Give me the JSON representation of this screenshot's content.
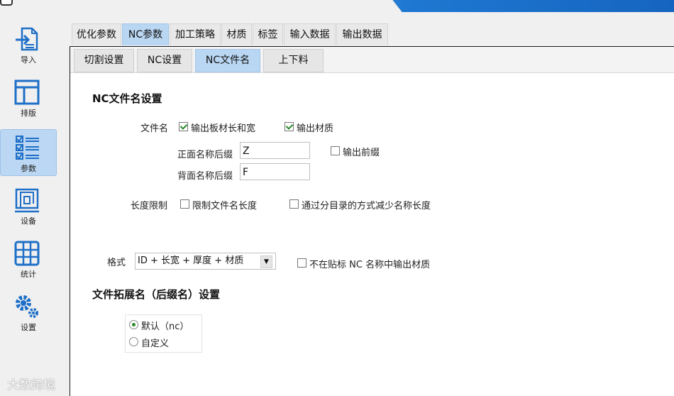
{
  "sidebar": {
    "items": [
      {
        "label": "导入",
        "icon": "import-icon"
      },
      {
        "label": "排版",
        "icon": "layout-icon"
      },
      {
        "label": "参数",
        "icon": "parameters-icon"
      },
      {
        "label": "设备",
        "icon": "machine-icon"
      },
      {
        "label": "统计",
        "icon": "statistics-icon"
      },
      {
        "label": "设置",
        "icon": "settings-gear-icon"
      }
    ],
    "active": "参数"
  },
  "main_tabs": [
    "优化参数",
    "NC参数",
    "加工策略",
    "材质",
    "标签",
    "输入数据",
    "输出数据"
  ],
  "main_tab_active": "NC参数",
  "sub_tabs": [
    "切割设置",
    "NC设置",
    "NC文件名",
    "上下料"
  ],
  "sub_tab_active": "NC文件名",
  "nc_filename": {
    "section_title": "NC文件名设置",
    "filename_label": "文件名",
    "output_board_size_label": "输出板材长和宽",
    "output_board_size_checked": true,
    "output_material_label": "输出材质",
    "output_material_checked": true,
    "front_suffix_label": "正面名称后缀",
    "front_suffix_value": "Z",
    "back_suffix_label": "背面名称后缀",
    "back_suffix_value": "F",
    "output_prefix_label": "输出前缀",
    "output_prefix_checked": false,
    "length_limit_label": "长度限制",
    "limit_filename_length_label": "限制文件名长度",
    "limit_filename_length_checked": false,
    "subdir_reduce_label": "通过分目录的方式减少名称长度",
    "subdir_reduce_checked": false,
    "format_label": "格式",
    "format_value": "ID + 长宽 + 厚度 + 材质",
    "no_material_in_label_label": "不在贴标 NC 名称中输出材质",
    "no_material_in_label_checked": false
  },
  "extension": {
    "section_title": "文件拓展名（后缀名）设置",
    "options": [
      "默认（nc）",
      "自定义"
    ],
    "selected": "默认（nc）"
  },
  "watermark": "大数跨境",
  "colors": {
    "active_tab": "#b9d6f2",
    "icon_blue": "#1e6fc8",
    "check_green": "#2a8a2a"
  }
}
